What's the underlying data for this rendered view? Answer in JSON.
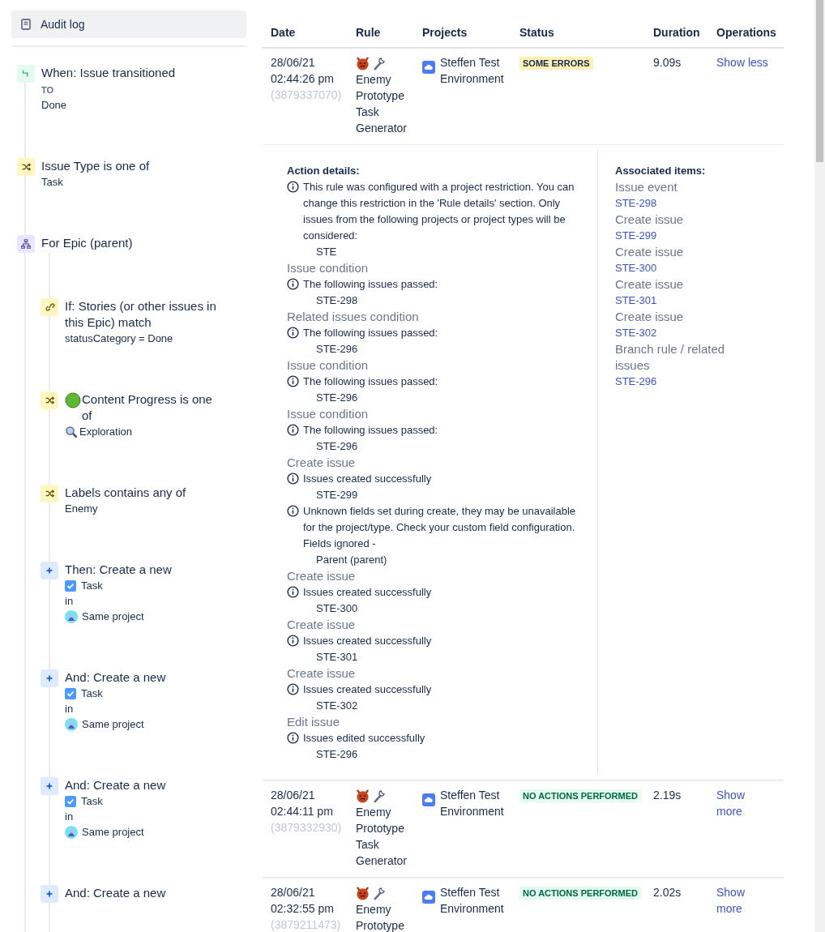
{
  "sidebar": {
    "nav": [
      {
        "label": "Audit log",
        "selected": true
      }
    ],
    "steps": [
      {
        "kind": "trigger",
        "title": "When: Issue transitioned",
        "details": [
          {
            "kind": "caption",
            "text": "TO"
          },
          {
            "kind": "text",
            "text": "Done"
          }
        ]
      },
      {
        "kind": "condition",
        "title": "Issue Type is one of",
        "details": [
          {
            "kind": "text",
            "text": "Task"
          }
        ]
      },
      {
        "kind": "branch",
        "title": "For Epic (parent)",
        "children": [
          {
            "kind": "link",
            "title": "If: Stories (or other issues in this Epic) match",
            "details": [
              {
                "kind": "text",
                "text": "statusCategory = Done"
              }
            ]
          },
          {
            "kind": "condition",
            "title": {
              "kind": "dot",
              "text": "Content Progress is one of"
            },
            "details": [
              {
                "kind": "magnifier",
                "text": "Exploration"
              }
            ]
          },
          {
            "kind": "condition",
            "title": "Labels contains any of",
            "details": [
              {
                "kind": "text",
                "text": "Enemy"
              }
            ]
          },
          {
            "kind": "action",
            "title": "Then: Create a new",
            "details": [
              {
                "kind": "task",
                "text": "Task"
              },
              {
                "kind": "text",
                "text": "in"
              },
              {
                "kind": "project",
                "text": "Same project"
              }
            ]
          },
          {
            "kind": "action",
            "title": "And: Create a new",
            "details": [
              {
                "kind": "task",
                "text": "Task"
              },
              {
                "kind": "text",
                "text": "in"
              },
              {
                "kind": "project",
                "text": "Same project"
              }
            ]
          },
          {
            "kind": "action",
            "title": "And: Create a new",
            "details": [
              {
                "kind": "task",
                "text": "Task"
              },
              {
                "kind": "text",
                "text": "in"
              },
              {
                "kind": "project",
                "text": "Same project"
              }
            ]
          },
          {
            "kind": "action",
            "title": "And: Create a new"
          }
        ]
      }
    ]
  },
  "table": {
    "columns": [
      "Date",
      "Rule",
      "Projects",
      "Status",
      "Duration",
      "Operations"
    ],
    "rows": [
      {
        "date": "28/06/21",
        "time": "02:44:26 pm",
        "run_id": "(3879337070)",
        "rule": "Enemy Prototype Task Generator",
        "project": "Steffen Test Environment",
        "status": {
          "label": "SOME ERRORS",
          "kind": "error"
        },
        "duration": "9.09s",
        "operation": "Show less",
        "details": {
          "heading": "Action details:",
          "groups": [
            {
              "messages": [
                {
                  "text": "This rule was configured with a project restriction. You can change this restriction in the 'Rule details' section. Only issues from the following projects or project types will be considered:",
                  "items": [
                    "STE"
                  ]
                }
              ]
            },
            {
              "heading": "Issue condition",
              "messages": [
                {
                  "text": "The following issues passed:",
                  "items": [
                    "STE-298"
                  ]
                }
              ]
            },
            {
              "heading": "Related issues condition",
              "messages": [
                {
                  "text": "The following issues passed:",
                  "items": [
                    "STE-296"
                  ]
                }
              ]
            },
            {
              "heading": "Issue condition",
              "messages": [
                {
                  "text": "The following issues passed:",
                  "items": [
                    "STE-296"
                  ]
                }
              ]
            },
            {
              "heading": "Issue condition",
              "messages": [
                {
                  "text": "The following issues passed:",
                  "items": [
                    "STE-296"
                  ]
                }
              ]
            },
            {
              "heading": "Create issue",
              "messages": [
                {
                  "text": "Issues created successfully",
                  "items": [
                    "STE-299"
                  ]
                },
                {
                  "text": "Unknown fields set during create, they may be unavailable for the project/type. Check your custom field configuration. Fields ignored -",
                  "items": [
                    "Parent (parent)"
                  ]
                }
              ]
            },
            {
              "heading": "Create issue",
              "messages": [
                {
                  "text": "Issues created successfully",
                  "items": [
                    "STE-300"
                  ]
                }
              ]
            },
            {
              "heading": "Create issue",
              "messages": [
                {
                  "text": "Issues created successfully",
                  "items": [
                    "STE-301"
                  ]
                }
              ]
            },
            {
              "heading": "Create issue",
              "messages": [
                {
                  "text": "Issues created successfully",
                  "items": [
                    "STE-302"
                  ]
                }
              ]
            },
            {
              "heading": "Edit issue",
              "messages": [
                {
                  "text": "Issues edited successfully",
                  "items": [
                    "STE-296"
                  ]
                }
              ]
            }
          ],
          "associated_heading": "Associated items:",
          "associated": [
            {
              "label": "Issue event",
              "link": "STE-298"
            },
            {
              "label": "Create issue",
              "link": "STE-299"
            },
            {
              "label": "Create issue",
              "link": "STE-300"
            },
            {
              "label": "Create issue",
              "link": "STE-301"
            },
            {
              "label": "Create issue",
              "link": "STE-302"
            },
            {
              "label": "Branch rule / related issues",
              "link": "STE-296"
            }
          ]
        }
      },
      {
        "date": "28/06/21",
        "time": "02:44:11 pm",
        "run_id": "(3879332930)",
        "rule": "Enemy Prototype Task Generator",
        "project": "Steffen Test Environment",
        "status": {
          "label": "NO ACTIONS PERFORMED",
          "kind": "success"
        },
        "duration": "2.19s",
        "operation": "Show more"
      },
      {
        "date": "28/06/21",
        "time": "02:32:55 pm",
        "run_id": "(3879211473)",
        "rule": "Enemy Prototype",
        "project": "Steffen Test Environment",
        "status": {
          "label": "NO ACTIONS PERFORMED",
          "kind": "success"
        },
        "duration": "2.02s",
        "operation": "Show more"
      }
    ]
  }
}
